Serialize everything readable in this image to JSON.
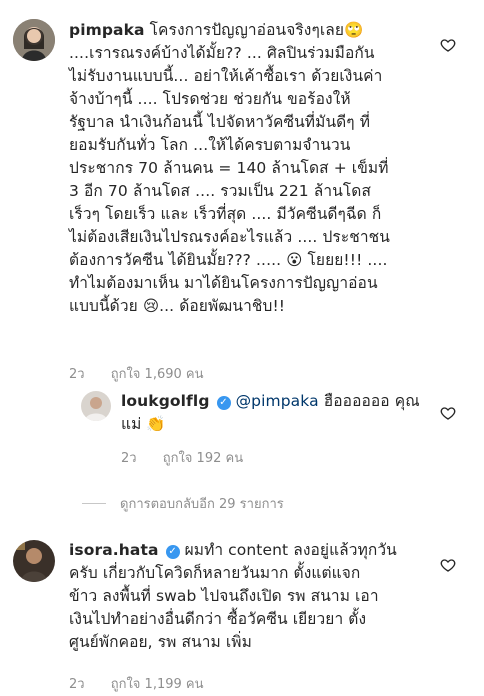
{
  "comments": [
    {
      "username": "pimpaka",
      "text_lines": [
        "โครงการปัญญาอ่อนจริงๆเลย🙄",
        "....เรารณรงค์บ้างได้มั้ย?? ... ศิลปินร่วมมือกัน",
        "ไม่รับงานแบบนี้... อย่าให้เค้าซื้อเรา ด้วยเงินค่า",
        "จ้างบ้าๆนี้ .... โปรดช่วย ช่วยกัน ขอร้องให้",
        "รัฐบาล  นำเงินก้อนนี้ ไปจัดหาวัคซีนที่มันดีๆ ที่",
        "ยอมรับกันทั่ว โลก ...ให้ได้ครบตามจำนวน",
        "ประชากร 70 ล้านคน = 140 ล้านโดส + เข็มที่",
        "3 อีก 70 ล้านโดส .... รวมเป็น 221 ล้านโดส",
        "เร็วๆ โดยเร็ว และ เร็วที่สุด .... มีวัคซีนดีๆฉีด ก็",
        "ไม่ต้องเสียเงินไปรณรงค์อะไรแล้ว .... ประชาชน",
        "ต้องการวัคซีน ได้ยินมั้ย??? ..... 😮 โยยย!!! ....",
        "ทำไมต้องมาเห็น มาได้ยินโครงการปัญญาอ่อน",
        "แบบนี้ด้วย 😢... ด้อยพัฒนาชิบ!!"
      ],
      "time": "2ว",
      "likes": "ถูกใจ 1,690 คน"
    },
    {
      "username": "loukgolflg",
      "verified": true,
      "mention": "@pimpaka",
      "text_after_mention": " ฮืออออออ คุณ",
      "text_line2": "แม่ 👏",
      "time": "2ว",
      "likes": "ถูกใจ 192 คน"
    },
    {
      "username": "isora.hata",
      "verified": true,
      "text_lines": [
        " ผมทำ content ลงอยู่แล้วทุกวัน",
        "ครับ เกี่ยวกับโควิดก็หลายวันมาก ตั้งแต่แจก",
        "ข้าว ลงพื้นที่ swab ไปจนถึงเปิด รพ สนาม  เอา",
        "เงินไปทำอย่างอื่นดีกว่า ซื้อวัคซีน เยียวยา ตั้ง",
        "ศูนย์พักคอย, รพ สนาม เพิ่ม"
      ],
      "time": "2ว",
      "likes": "ถูกใจ 1,199 คน"
    }
  ],
  "view_replies": "ดูการตอบกลับอีก 29 รายการ",
  "icons": {
    "heart": "heart-icon",
    "verified": "verified-badge-icon"
  }
}
